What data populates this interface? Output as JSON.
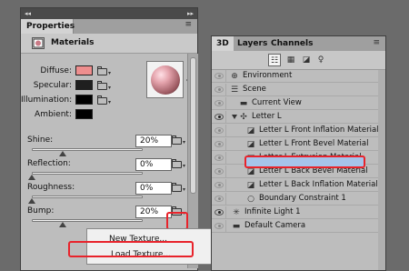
{
  "properties_panel": {
    "tab_label": "Properties",
    "header_title": "Materials",
    "color_rows": [
      {
        "label": "Diffuse:",
        "color": "#ee8e8e"
      },
      {
        "label": "Specular:",
        "color": "#1f1f1f"
      },
      {
        "label": "Illumination:",
        "color": "#000000"
      },
      {
        "label": "Ambient:",
        "color": "#000000"
      }
    ],
    "sliders": [
      {
        "label": "Shine:",
        "value": "20%",
        "fraction": 0.28
      },
      {
        "label": "Reflection:",
        "value": "0%",
        "fraction": 0.0
      },
      {
        "label": "Roughness:",
        "value": "0%",
        "fraction": 0.0
      },
      {
        "label": "Bump:",
        "value": "20%",
        "fraction": 0.28
      }
    ],
    "context_menu": {
      "items": [
        "New Texture...",
        "Load Texture..."
      ]
    },
    "icons": [
      "materials-icon",
      "folder-icon",
      "sphere-preview"
    ]
  },
  "scene_panel": {
    "tabs": [
      "3D",
      "Layers",
      "Channels"
    ],
    "active_tab": "3D",
    "rows": [
      {
        "label": "Environment",
        "icon": "globe-icon",
        "eye": "dim"
      },
      {
        "label": "Scene",
        "icon": "scene-icon",
        "eye": "dim"
      },
      {
        "label": "Current View",
        "icon": "camera-icon",
        "eye": "dim"
      },
      {
        "label": "Letter L",
        "icon": "mesh-icon",
        "eye": "on"
      },
      {
        "label": "Letter L Front Inflation Material",
        "icon": "material-icon",
        "eye": "dim"
      },
      {
        "label": "Letter L Front Bevel Material",
        "icon": "material-icon",
        "eye": "dim"
      },
      {
        "label": "Letter L Extrusion Material",
        "icon": "material-icon",
        "eye": "dim",
        "selected": true
      },
      {
        "label": "Letter L Back Bevel Material",
        "icon": "material-icon",
        "eye": "dim"
      },
      {
        "label": "Letter L Back Inflation Material",
        "icon": "material-icon",
        "eye": "dim"
      },
      {
        "label": "Boundary Constraint 1",
        "icon": "constraint-icon",
        "eye": "dim"
      },
      {
        "label": "Infinite Light 1",
        "icon": "light-icon",
        "eye": "on"
      },
      {
        "label": "Default Camera",
        "icon": "camera-icon",
        "eye": "dim"
      }
    ],
    "highlight_color": "#a6c4ea",
    "annotation_color": "#e8232b"
  }
}
